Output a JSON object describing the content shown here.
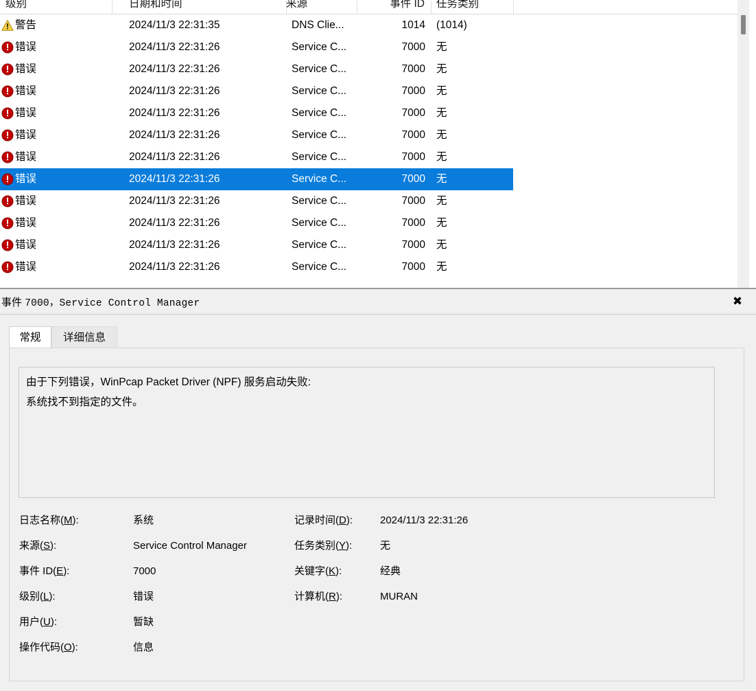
{
  "event_list": {
    "columns": [
      {
        "key": "level",
        "label": "级别"
      },
      {
        "key": "datetime",
        "label": "日期和时间"
      },
      {
        "key": "source",
        "label": "来源"
      },
      {
        "key": "event_id",
        "label": "事件 ID"
      },
      {
        "key": "category",
        "label": "任务类别"
      }
    ],
    "rows": [
      {
        "icon": "warning-icon",
        "level": "警告",
        "datetime": "2024/11/3 22:31:35",
        "source": "DNS Clie...",
        "event_id": "1014",
        "category": "(1014)",
        "selected": false
      },
      {
        "icon": "error-icon",
        "level": "错误",
        "datetime": "2024/11/3 22:31:26",
        "source": "Service C...",
        "event_id": "7000",
        "category": "无",
        "selected": false
      },
      {
        "icon": "error-icon",
        "level": "错误",
        "datetime": "2024/11/3 22:31:26",
        "source": "Service C...",
        "event_id": "7000",
        "category": "无",
        "selected": false
      },
      {
        "icon": "error-icon",
        "level": "错误",
        "datetime": "2024/11/3 22:31:26",
        "source": "Service C...",
        "event_id": "7000",
        "category": "无",
        "selected": false
      },
      {
        "icon": "error-icon",
        "level": "错误",
        "datetime": "2024/11/3 22:31:26",
        "source": "Service C...",
        "event_id": "7000",
        "category": "无",
        "selected": false
      },
      {
        "icon": "error-icon",
        "level": "错误",
        "datetime": "2024/11/3 22:31:26",
        "source": "Service C...",
        "event_id": "7000",
        "category": "无",
        "selected": false
      },
      {
        "icon": "error-icon",
        "level": "错误",
        "datetime": "2024/11/3 22:31:26",
        "source": "Service C...",
        "event_id": "7000",
        "category": "无",
        "selected": false
      },
      {
        "icon": "error-icon",
        "level": "错误",
        "datetime": "2024/11/3 22:31:26",
        "source": "Service C...",
        "event_id": "7000",
        "category": "无",
        "selected": true
      },
      {
        "icon": "error-icon",
        "level": "错误",
        "datetime": "2024/11/3 22:31:26",
        "source": "Service C...",
        "event_id": "7000",
        "category": "无",
        "selected": false
      },
      {
        "icon": "error-icon",
        "level": "错误",
        "datetime": "2024/11/3 22:31:26",
        "source": "Service C...",
        "event_id": "7000",
        "category": "无",
        "selected": false
      },
      {
        "icon": "error-icon",
        "level": "错误",
        "datetime": "2024/11/3 22:31:26",
        "source": "Service C...",
        "event_id": "7000",
        "category": "无",
        "selected": false
      },
      {
        "icon": "error-icon",
        "level": "错误",
        "datetime": "2024/11/3 22:31:26",
        "source": "Service C...",
        "event_id": "7000",
        "category": "无",
        "selected": false
      }
    ]
  },
  "detail": {
    "title_prefix": "事件",
    "title_mono": "7000，Service Control Manager",
    "close_glyph": "✖",
    "tabs": [
      {
        "label": "常规",
        "active": true
      },
      {
        "label": "详细信息",
        "active": false
      }
    ],
    "message_lines": [
      "由于下列错误，WinPcap Packet Driver (NPF) 服务启动失败:",
      "系统找不到指定的文件。"
    ],
    "fields_left": [
      {
        "label_pre": "日志名称(",
        "accel": "M",
        "label_post": "):",
        "value": "系统"
      },
      {
        "label_pre": "来源(",
        "accel": "S",
        "label_post": "):",
        "value": "Service Control Manager"
      },
      {
        "label_pre": "事件 ID(",
        "accel": "E",
        "label_post": "):",
        "value": "7000"
      },
      {
        "label_pre": "级别(",
        "accel": "L",
        "label_post": "):",
        "value": "错误"
      },
      {
        "label_pre": "用户(",
        "accel": "U",
        "label_post": "):",
        "value": "暂缺"
      },
      {
        "label_pre": "操作代码(",
        "accel": "O",
        "label_post": "):",
        "value": "信息"
      }
    ],
    "fields_right": [
      {
        "label_pre": "记录时间(",
        "accel": "D",
        "label_post": "):",
        "value": "2024/11/3 22:31:26"
      },
      {
        "label_pre": "任务类别(",
        "accel": "Y",
        "label_post": "):",
        "value": "无"
      },
      {
        "label_pre": "关键字(",
        "accel": "K",
        "label_post": "):",
        "value": "经典"
      },
      {
        "label_pre": "计算机(",
        "accel": "R",
        "label_post": "):",
        "value": "MURAN"
      }
    ]
  },
  "colors": {
    "selection_blue": "#0a7cdb",
    "error_red": "#c00000",
    "warning_yellow": "#f5c518",
    "pane_background": "#f0f0f0"
  }
}
